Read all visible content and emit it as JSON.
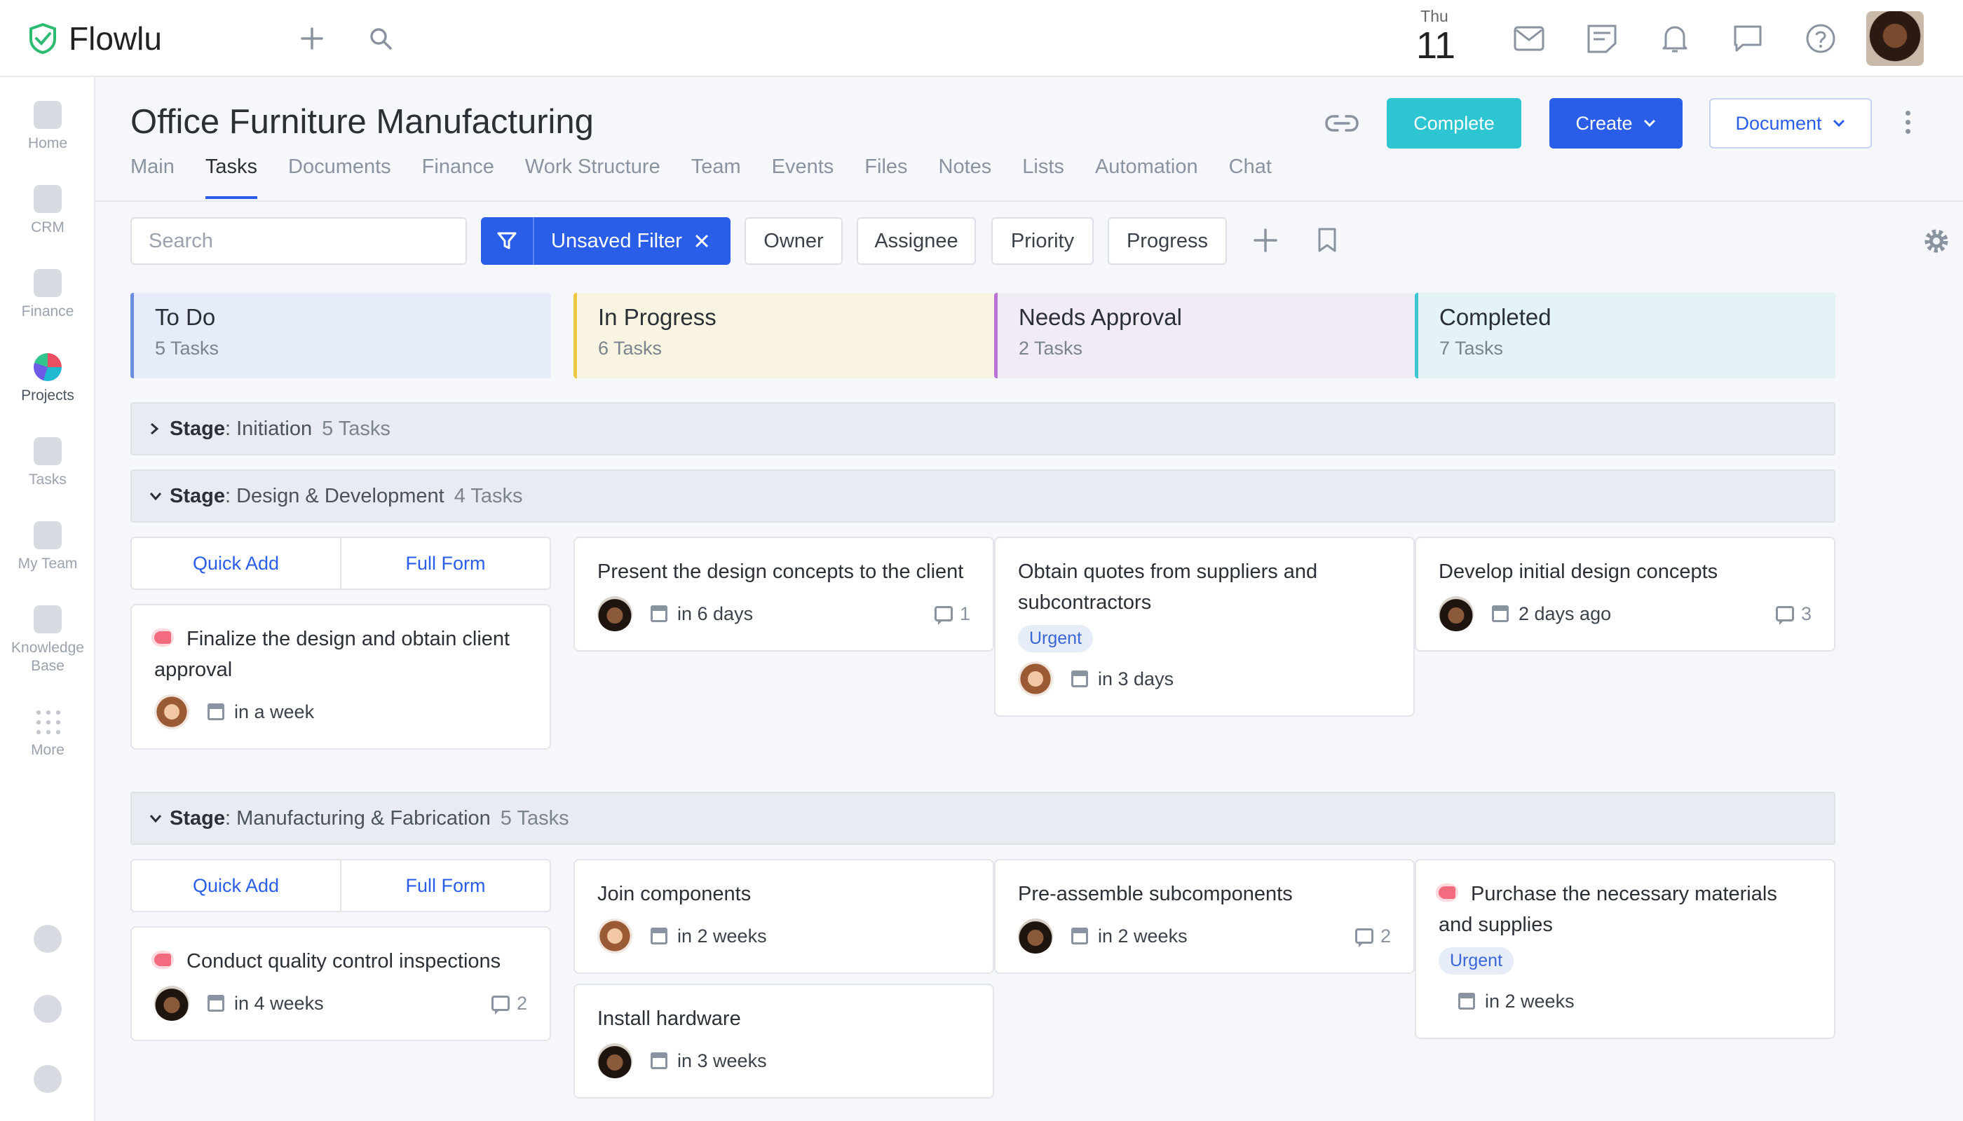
{
  "app": {
    "name": "Flowlu"
  },
  "topbar": {
    "day_of_week": "Thu",
    "day_number": "11"
  },
  "sidebar": {
    "items": [
      {
        "label": "Home",
        "icon": "home-icon"
      },
      {
        "label": "CRM",
        "icon": "crm-funnel-icon"
      },
      {
        "label": "Finance",
        "icon": "finance-icon"
      },
      {
        "label": "Projects",
        "icon": "projects-icon",
        "active": true
      },
      {
        "label": "Tasks",
        "icon": "tasks-icon"
      },
      {
        "label": "My Team",
        "icon": "team-icon"
      },
      {
        "label": "Knowledge Base",
        "icon": "knowledge-base-icon"
      },
      {
        "label": "More",
        "icon": "grid-dots-icon"
      }
    ]
  },
  "project": {
    "title": "Office Furniture Manufacturing",
    "actions": {
      "complete": "Complete",
      "create": "Create",
      "document": "Document"
    },
    "tabs": [
      "Main",
      "Tasks",
      "Documents",
      "Finance",
      "Work Structure",
      "Team",
      "Events",
      "Files",
      "Notes",
      "Lists",
      "Automation",
      "Chat"
    ],
    "active_tab": "Tasks"
  },
  "filters": {
    "search_placeholder": "Search",
    "active_filter": "Unsaved Filter",
    "chips": [
      "Owner",
      "Assignee",
      "Priority",
      "Progress"
    ]
  },
  "columns": [
    {
      "title": "To Do",
      "count": "5 Tasks",
      "color": "#6b8de0",
      "bg": "#e6ecfa"
    },
    {
      "title": "In Progress",
      "count": "6 Tasks",
      "color": "#f2c744",
      "bg": "#f8f4e1"
    },
    {
      "title": "Needs Approval",
      "count": "2 Tasks",
      "color": "#b86fd6",
      "bg": "#f1ebf6"
    },
    {
      "title": "Completed",
      "count": "7 Tasks",
      "color": "#3ec5d3",
      "bg": "#e3f3f6"
    }
  ],
  "stages": [
    {
      "label": "Stage",
      "name": ": Initiation",
      "count": "5 Tasks",
      "collapsed": true
    },
    {
      "label": "Stage",
      "name": ": Design & Development",
      "count": "4 Tasks",
      "collapsed": false
    },
    {
      "label": "Stage",
      "name": ": Manufacturing & Fabrication",
      "count": "5 Tasks",
      "collapsed": false
    }
  ],
  "quick_add": {
    "quick": "Quick Add",
    "full": "Full Form"
  },
  "cards": {
    "c1": {
      "title": "Finalize the design and obtain client approval",
      "due": "in a week",
      "urgent_flag": true
    },
    "c2": {
      "title": "Present the design concepts to the client",
      "due": "in 6 days",
      "comments": "1"
    },
    "c3": {
      "title": "Obtain quotes from suppliers and subcontractors",
      "badge": "Urgent",
      "due": "in 3 days"
    },
    "c4": {
      "title": "Develop initial design concepts",
      "due": "2 days ago",
      "comments": "3"
    },
    "c5": {
      "title": "Conduct quality control inspections",
      "due": "in 4 weeks",
      "comments": "2",
      "urgent_flag": true
    },
    "c6": {
      "title": "Join components",
      "due": "in 2 weeks"
    },
    "c7": {
      "title": "Install hardware",
      "due": "in 3 weeks"
    },
    "c8": {
      "title": "Pre-assemble subcomponents",
      "due": "in 2 weeks",
      "comments": "2"
    },
    "c9": {
      "title": "Purchase the necessary materials and supplies",
      "badge": "Urgent",
      "due": "in 2 weeks",
      "urgent_flag": true
    }
  }
}
